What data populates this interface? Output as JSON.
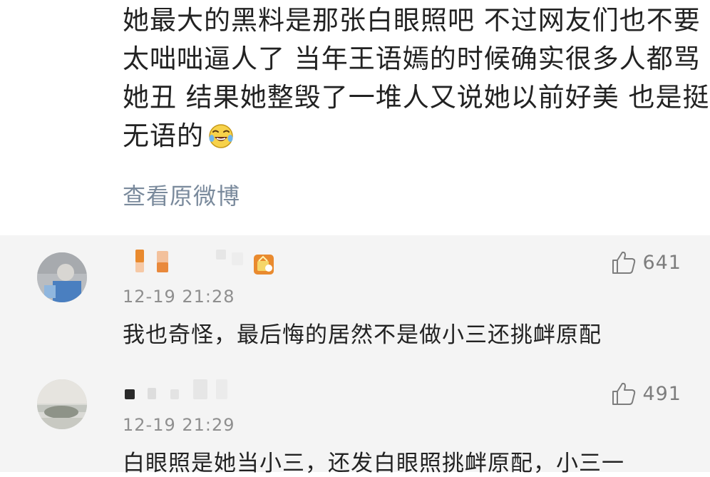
{
  "post": {
    "lines": [
      "她最大的黑料是那张白眼照吧 不过网友们也不要",
      "太咄咄逼人了 当年王语嫣的时候确实很多人都骂",
      "她丑 结果她整毁了一堆人又说她以前好美 也是挺",
      "无语的"
    ],
    "emoji": "laugh-cry-emoji",
    "view_original": "查看原微博"
  },
  "comments": [
    {
      "username": "",
      "time": "12-19 21:28",
      "text": "我也奇怪，最后悔的居然不是做小三还挑衅原配",
      "likes": "641",
      "badge": "vip-badge-icon"
    },
    {
      "username": "",
      "time": "12-19 21:29",
      "text": "白眼照是她当小三，还发白眼照挑衅原配，小三一",
      "likes": "491",
      "badge": ""
    }
  ],
  "colors": {
    "text": "#222222",
    "link": "#7a8a9c",
    "meta": "#8f8f8f",
    "comment_bg": "#f4f4f4",
    "badge": "#e98a2e"
  }
}
